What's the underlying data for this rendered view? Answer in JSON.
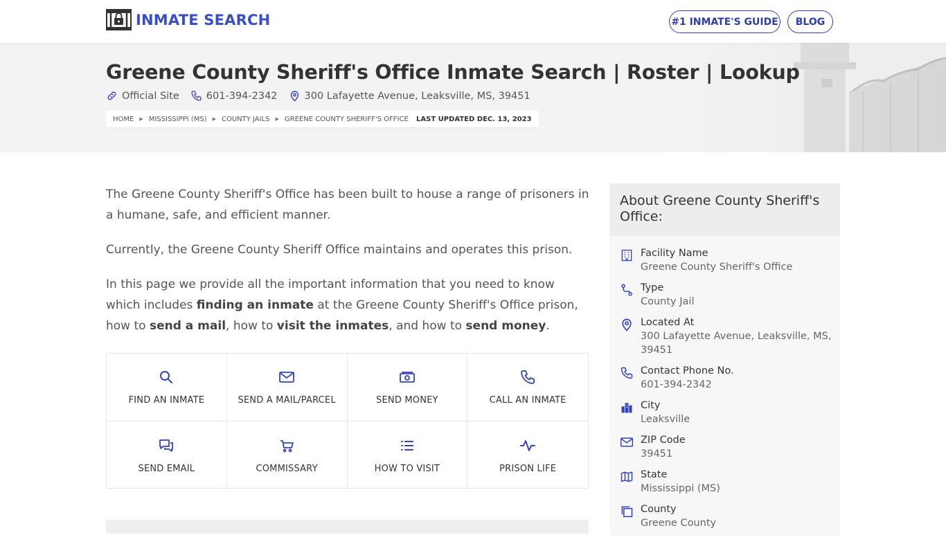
{
  "header": {
    "logo_text": "INMATE SEARCH",
    "nav": [
      {
        "label": "#1 INMATE'S GUIDE"
      },
      {
        "label": "BLOG"
      }
    ]
  },
  "hero": {
    "title": "Greene County Sheriff's Office Inmate Search | Roster | Lookup",
    "official_site": "Official Site",
    "phone": "601-394-2342",
    "address": "300 Lafayette Avenue, Leaksville, MS, 39451",
    "breadcrumbs": [
      "HOME",
      "MISSISSIPPI (MS)",
      "COUNTY JAILS",
      "GREENE COUNTY SHERIFF'S OFFICE"
    ],
    "updated": "LAST UPDATED DEC. 13, 2023"
  },
  "intro": {
    "p1": "The Greene County Sheriff's Office has been built to house a range of prisoners in a humane, safe, and efficient manner.",
    "p2": "Currently, the Greene County Sheriff Office maintains and operates this prison.",
    "p3_a": "In this page we provide all the important information that you need to know which includes ",
    "p3_b": "finding an inmate",
    "p3_c": " at the Greene County Sheriff's Office prison, how to ",
    "p3_d": "send a mail",
    "p3_e": ", how to ",
    "p3_f": "visit the inmates",
    "p3_g": ", and how to ",
    "p3_h": "send money",
    "p3_i": "."
  },
  "actions": [
    {
      "label": "FIND AN INMATE",
      "icon": "search-icon"
    },
    {
      "label": "SEND A MAIL/PARCEL",
      "icon": "envelope-icon"
    },
    {
      "label": "SEND MONEY",
      "icon": "money-icon"
    },
    {
      "label": "CALL AN INMATE",
      "icon": "phone-icon"
    },
    {
      "label": "SEND EMAIL",
      "icon": "chat-icon"
    },
    {
      "label": "COMMISSARY",
      "icon": "cart-icon"
    },
    {
      "label": "HOW TO VISIT",
      "icon": "list-icon"
    },
    {
      "label": "PRISON LIFE",
      "icon": "pulse-icon"
    }
  ],
  "sidebar": {
    "title": "About Greene County Sheriff's Office:",
    "items": [
      {
        "label": "Facility Name",
        "value": "Greene County Sheriff's Office",
        "icon": "building-icon"
      },
      {
        "label": "Type",
        "value": "County Jail",
        "icon": "route-icon"
      },
      {
        "label": "Located At",
        "value": "300 Lafayette Avenue, Leaksville, MS, 39451",
        "icon": "location-pin-icon"
      },
      {
        "label": "Contact Phone No.",
        "value": "601-394-2342",
        "icon": "phone-icon"
      },
      {
        "label": "City",
        "value": "Leaksville",
        "icon": "city-icon"
      },
      {
        "label": "ZIP Code",
        "value": "39451",
        "icon": "envelope-icon"
      },
      {
        "label": "State",
        "value": "Mississippi (MS)",
        "icon": "map-icon"
      },
      {
        "label": "County",
        "value": "Greene County",
        "icon": "copy-icon"
      }
    ]
  },
  "colors": {
    "accent": "#3a4fc7",
    "nav_border": "#2e3fa8",
    "icon": "#3344b8"
  }
}
